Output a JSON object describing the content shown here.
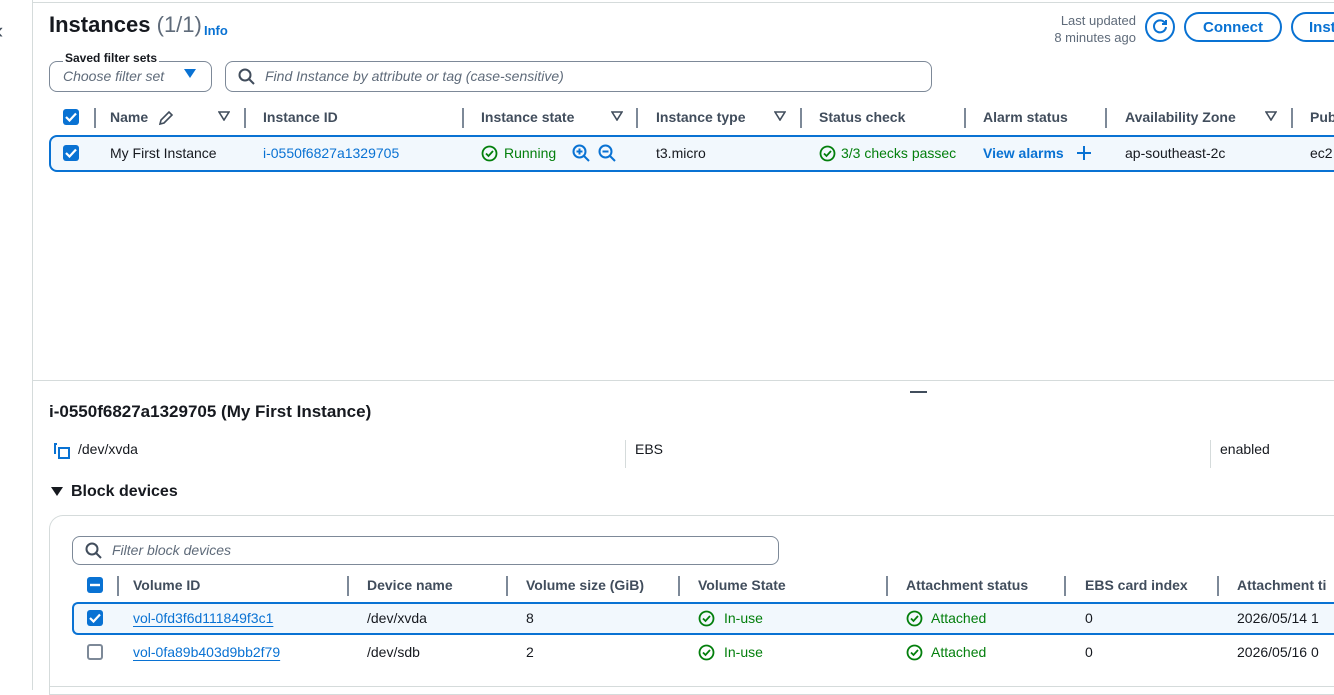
{
  "header": {
    "title": "Instances",
    "count": "(1/1)",
    "info": "Info",
    "last_updated_line1": "Last updated",
    "last_updated_line2": "8 minutes ago",
    "connect_label": "Connect",
    "instance_state_btn_label": "Inst"
  },
  "filters": {
    "saved_label": "Saved filter sets",
    "saved_placeholder": "Choose filter set",
    "search_placeholder": "Find Instance by attribute or tag (case-sensitive)"
  },
  "instances_table": {
    "columns": [
      "Name",
      "Instance ID",
      "Instance state",
      "Instance type",
      "Status check",
      "Alarm status",
      "Availability Zone",
      "Pub"
    ],
    "rows": [
      {
        "name": "My First Instance",
        "instance_id": "i-0550f6827a1329705",
        "state": "Running",
        "type": "t3.micro",
        "status_check": "3/3 checks passec",
        "alarm": "View alarms",
        "az": "ap-southeast-2c",
        "public": "ec2"
      }
    ]
  },
  "details": {
    "title": "i-0550f6827a1329705 (My First Instance)",
    "root_device": "/dev/xvda",
    "root_type": "EBS",
    "ebs_optimized": "enabled"
  },
  "block_devices": {
    "heading": "Block devices",
    "filter_placeholder": "Filter block devices",
    "columns": [
      "Volume ID",
      "Device name",
      "Volume size (GiB)",
      "Volume State",
      "Attachment status",
      "EBS card index",
      "Attachment ti"
    ],
    "rows": [
      {
        "volume_id": "vol-0fd3f6d111849f3c1",
        "device": "/dev/xvda",
        "size": "8",
        "state": "In-use",
        "attachment": "Attached",
        "card_index": "0",
        "attach_time": "2026/05/14 1"
      },
      {
        "volume_id": "vol-0fa89b403d9bb2f79",
        "device": "/dev/sdb",
        "size": "2",
        "state": "In-use",
        "attachment": "Attached",
        "card_index": "0",
        "attach_time": "2026/05/16 0"
      }
    ]
  },
  "colors": {
    "accent": "#0972d3",
    "success": "#037f0c",
    "selected_bg": "#f2f8fd",
    "text": "#16191f"
  }
}
